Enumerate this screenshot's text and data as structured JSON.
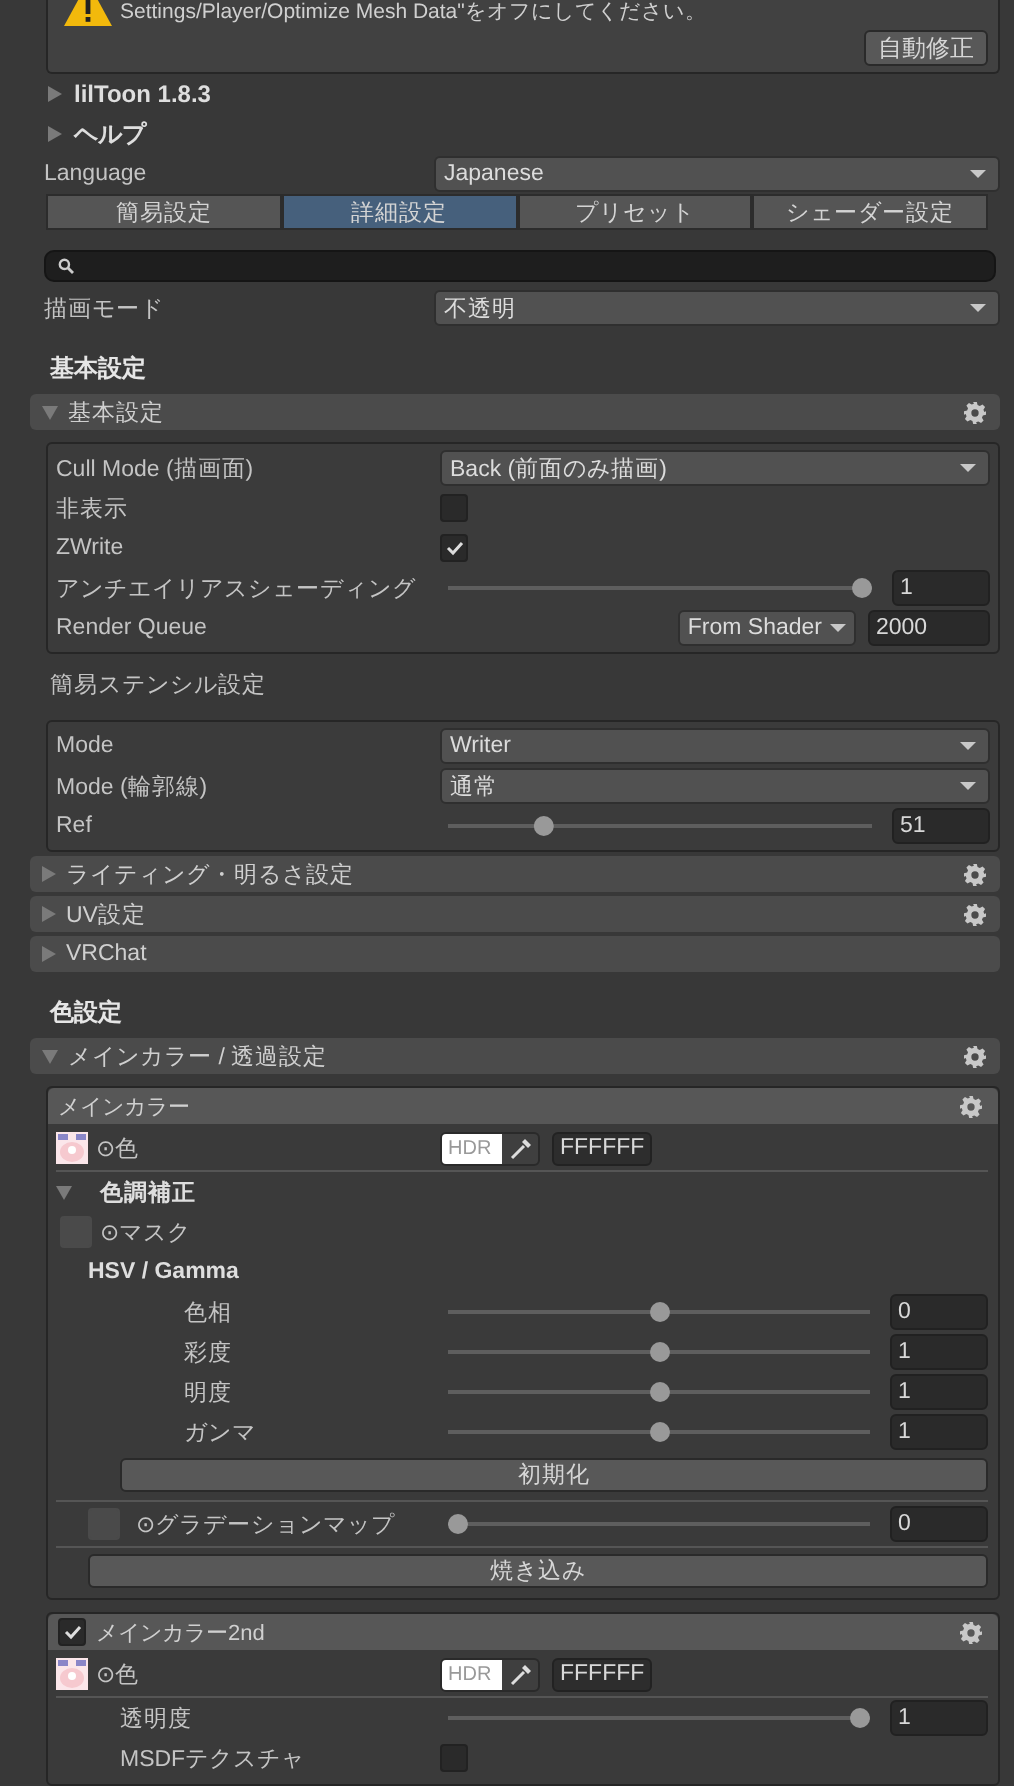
{
  "warning": {
    "text": "Settings/Player/Optimize Mesh Data\"をオフにしてください。",
    "button": "自動修正"
  },
  "foldouts": [
    {
      "label": "lilToon 1.8.3",
      "expanded": false
    },
    {
      "label": "ヘルプ",
      "expanded": false
    }
  ],
  "language": {
    "label": "Language",
    "value": "Japanese"
  },
  "tabs": [
    {
      "label": "簡易設定",
      "selected": false
    },
    {
      "label": "詳細設定",
      "selected": true
    },
    {
      "label": "プリセット",
      "selected": false
    },
    {
      "label": "シェーダー設定",
      "selected": false
    }
  ],
  "render_mode": {
    "label": "描画モード",
    "value": "不透明"
  },
  "items": [
    {
      "kind": "heading",
      "label": "基本設定"
    },
    {
      "kind": "section",
      "label": "基本設定",
      "expanded": true,
      "gear": true
    },
    {
      "kind": "box",
      "rows": [
        {
          "kind": "dropdown",
          "label": "Cull Mode (描画面)",
          "value": "Back (前面のみ描画)"
        },
        {
          "kind": "checkbox",
          "label": "非表示",
          "checked": false
        },
        {
          "kind": "checkbox",
          "label": "ZWrite",
          "checked": true
        },
        {
          "kind": "slider",
          "label": "アンチエイリアスシェーディング",
          "level": 1,
          "value": "1"
        },
        {
          "kind": "queue",
          "label": "Render Queue",
          "source": "From Shader",
          "value": "2000"
        }
      ]
    },
    {
      "kind": "subheading",
      "label": "簡易ステンシル設定"
    },
    {
      "kind": "box",
      "rows": [
        {
          "kind": "dropdown",
          "label": "Mode",
          "value": "Writer"
        },
        {
          "kind": "dropdown",
          "label": "Mode (輪郭線)",
          "value": "通常"
        },
        {
          "kind": "slider",
          "label": "Ref",
          "level": 0.21,
          "value": "51"
        }
      ]
    },
    {
      "kind": "section",
      "label": "ライティング・明るさ設定",
      "expanded": false,
      "gear": true
    },
    {
      "kind": "section",
      "label": "UV設定",
      "expanded": false,
      "gear": true
    },
    {
      "kind": "section",
      "label": "VRChat",
      "expanded": false,
      "gear": false
    },
    {
      "kind": "heading",
      "label": "色設定"
    },
    {
      "kind": "section",
      "label": "メインカラー / 透過設定",
      "expanded": true,
      "gear": true
    },
    {
      "kind": "panel",
      "title": "メインカラー",
      "gear": true,
      "rows": [
        {
          "kind": "color",
          "label": "⊙色",
          "hdr": "HDR",
          "value": "FFFFFF"
        },
        {
          "kind": "foldout",
          "label": "色調補正",
          "expanded": true,
          "children": [
            {
              "kind": "toggle",
              "label": "⊙マスク",
              "checked": false
            },
            {
              "kind": "group",
              "label": "HSV / Gamma",
              "children": [
                {
                  "kind": "slider",
                  "label": "色相",
                  "level": 0.5,
                  "value": "0"
                },
                {
                  "kind": "slider",
                  "label": "彩度",
                  "level": 0.5,
                  "value": "1"
                },
                {
                  "kind": "slider",
                  "label": "明度",
                  "level": 0.5,
                  "value": "1"
                },
                {
                  "kind": "slider",
                  "label": "ガンマ",
                  "level": 0.5,
                  "value": "1"
                },
                {
                  "kind": "button",
                  "label": "初期化"
                }
              ]
            },
            {
              "kind": "toggle-slider",
              "label": "⊙グラデーションマップ",
              "checked": false,
              "level": 0,
              "value": "0"
            },
            {
              "kind": "button",
              "label": "焼き込み"
            }
          ]
        }
      ]
    },
    {
      "kind": "panel",
      "title": "メインカラー2nd",
      "checked": true,
      "gear": true,
      "rows": [
        {
          "kind": "color",
          "label": "⊙色",
          "hdr": "HDR",
          "value": "FFFFFF",
          "children": [
            {
              "kind": "slider",
              "label": "透明度",
              "level": 1,
              "value": "1"
            },
            {
              "kind": "checkbox",
              "label": "MSDFテクスチャ",
              "checked": false
            }
          ]
        }
      ]
    }
  ]
}
